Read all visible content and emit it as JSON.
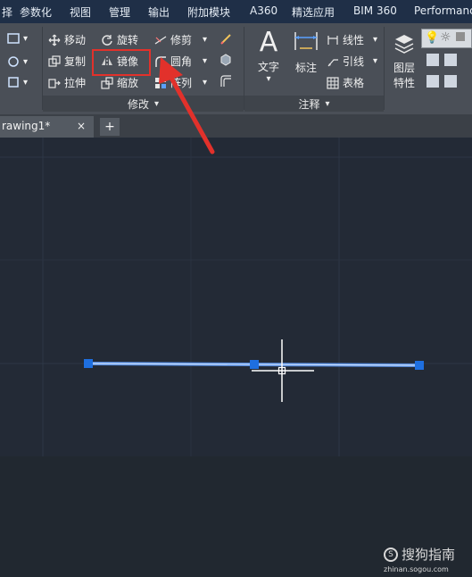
{
  "menubar": {
    "items": [
      "择",
      "参数化",
      "视图",
      "管理",
      "输出",
      "附加模块",
      "A360",
      "精选应用",
      "BIM 360",
      "Performance"
    ]
  },
  "ribbon": {
    "modify": {
      "move": "移动",
      "rotate": "旋转",
      "trim": "修剪",
      "copy": "复制",
      "mirror": "镜像",
      "fillet": "圆角",
      "stretch": "拉伸",
      "scale": "缩放",
      "array": "阵列",
      "panel_label": "修改"
    },
    "annotation": {
      "text": "文字",
      "dimension": "标注",
      "linear": "线性",
      "leader": "引线",
      "table": "表格",
      "panel_label": "注释"
    },
    "layers": {
      "layer_props_line1": "图层",
      "layer_props_line2": "特性"
    }
  },
  "tabs": {
    "drawing_tab": "rawing1*",
    "close": "×",
    "new_tab": "+"
  },
  "watermark": {
    "brand": "搜狗指南",
    "url": "zhinan.sogou.com"
  },
  "colors": {
    "highlight": "#e2312b",
    "arrow": "#e2312b",
    "line": "#5a8fe0",
    "grip": "#1e6fe0"
  }
}
